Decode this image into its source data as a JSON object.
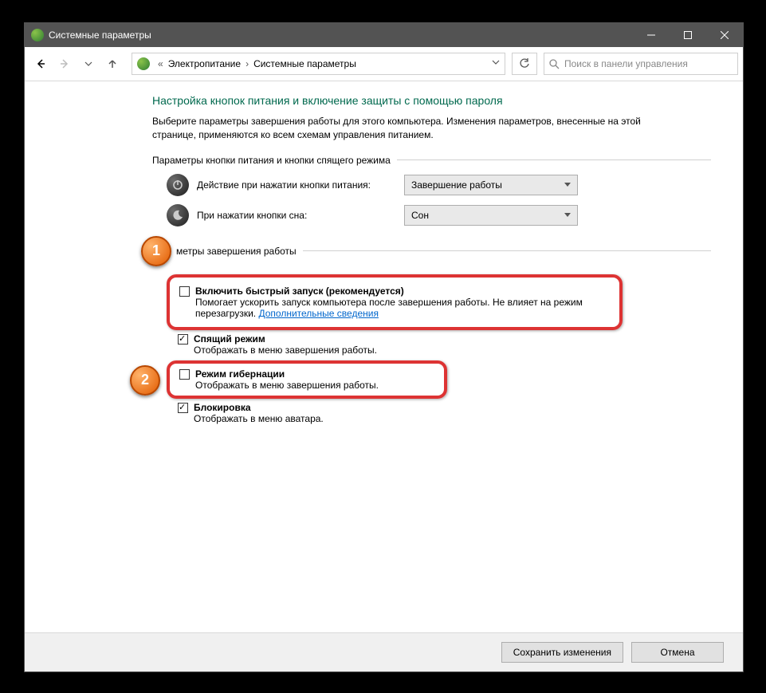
{
  "window": {
    "title": "Системные параметры"
  },
  "breadcrumb": {
    "item1": "Электропитание",
    "item2": "Системные параметры"
  },
  "search": {
    "placeholder": "Поиск в панели управления"
  },
  "page": {
    "title": "Настройка кнопок питания и включение защиты с помощью пароля",
    "desc": "Выберите параметры завершения работы для этого компьютера. Изменения параметров, внесенные на этой странице, применяются ко всем схемам управления питанием."
  },
  "section1": {
    "header": "Параметры кнопки питания и кнопки спящего режима",
    "power_btn_label": "Действие при нажатии кнопки питания:",
    "power_btn_value": "Завершение работы",
    "sleep_btn_label": "При нажатии кнопки сна:",
    "sleep_btn_value": "Сон"
  },
  "section2": {
    "header_partial": "метры завершения работы",
    "fast_startup": {
      "title": "Включить быстрый запуск (рекомендуется)",
      "desc": "Помогает ускорить запуск компьютера после завершения работы. Не влияет на режим перезагрузки. ",
      "link": "Дополнительные сведения",
      "checked": false
    },
    "sleep": {
      "title": "Спящий режим",
      "desc": "Отображать в меню завершения работы.",
      "checked": true
    },
    "hibernate": {
      "title": "Режим гибернации",
      "desc": "Отображать в меню завершения работы.",
      "checked": false
    },
    "lock": {
      "title": "Блокировка",
      "desc": "Отображать в меню аватара.",
      "checked": true
    }
  },
  "footer": {
    "save": "Сохранить изменения",
    "cancel": "Отмена"
  },
  "badges": {
    "b1": "1",
    "b2": "2"
  }
}
